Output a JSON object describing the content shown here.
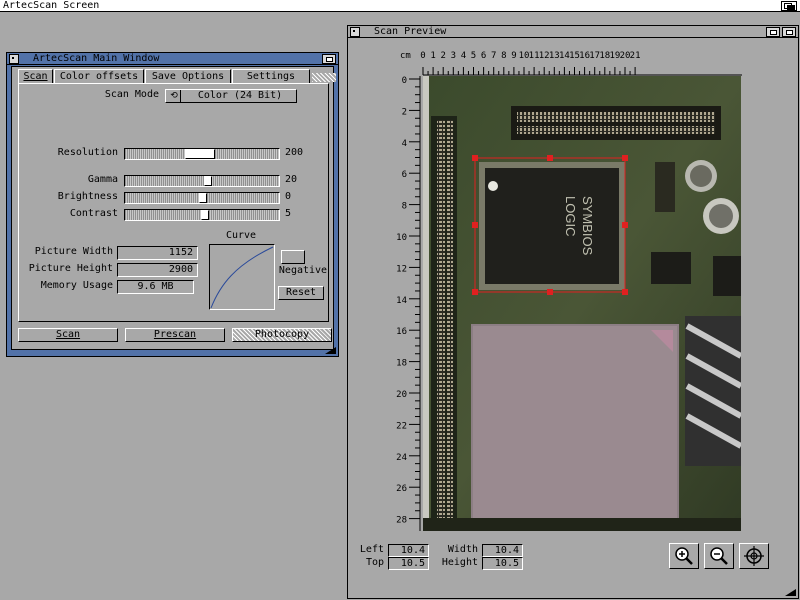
{
  "screen": {
    "title": "ArtecScan Screen"
  },
  "main_window": {
    "title": "ArtecScan Main Window",
    "tabs": [
      {
        "label": "Scan"
      },
      {
        "label": "Color offsets"
      },
      {
        "label": "Save Options"
      },
      {
        "label": "Settings"
      }
    ],
    "scan_mode": {
      "label": "Scan Mode",
      "value": "Color (24 Bit)"
    },
    "sliders": {
      "resolution": {
        "label": "Resolution",
        "value": "200",
        "level": 0.37
      },
      "gamma": {
        "label": "Gamma",
        "value": "20",
        "level": 0.53
      },
      "brightness": {
        "label": "Brightness",
        "value": "0",
        "level": 0.5
      },
      "contrast": {
        "label": "Contrast",
        "value": "5",
        "level": 0.52
      }
    },
    "info": {
      "picture_width": {
        "label": "Picture Width",
        "value": "1152"
      },
      "picture_height": {
        "label": "Picture Height",
        "value": "2900"
      },
      "memory_usage": {
        "label": "Memory Usage",
        "value": "9.6 MB"
      }
    },
    "curve_label": "Curve",
    "negative_label": "Negative",
    "reset_label": "Reset",
    "buttons": {
      "scan": "Scan",
      "prescan": "Prescan",
      "photocopy": "Photocopy"
    }
  },
  "preview_window": {
    "title": "Scan Preview",
    "ruler_unit": "cm",
    "ruler_top": [
      "0",
      "1",
      "2",
      "3",
      "4",
      "5",
      "6",
      "7",
      "8",
      "9",
      "10",
      "11",
      "12",
      "13",
      "14",
      "15",
      "16",
      "17",
      "18",
      "19",
      "20",
      "21"
    ],
    "ruler_left": [
      "0",
      "2",
      "4",
      "6",
      "8",
      "10",
      "12",
      "14",
      "16",
      "18",
      "20",
      "22",
      "24",
      "26",
      "28"
    ],
    "chip_text": [
      "SYMBIOS",
      "LOGIC"
    ],
    "coords": {
      "left": {
        "label": "Left",
        "value": "10.4"
      },
      "top": {
        "label": "Top",
        "value": "10.5"
      },
      "width": {
        "label": "Width",
        "value": "10.4"
      },
      "height": {
        "label": "Height",
        "value": "10.5"
      }
    },
    "tools": [
      "zoom-in-icon",
      "zoom-out-icon",
      "crosshair-icon"
    ]
  },
  "colors": {
    "workbench_gray": "#a8a8a8",
    "active_title_blue": "#5272a8",
    "selection_red": "#e02020"
  }
}
